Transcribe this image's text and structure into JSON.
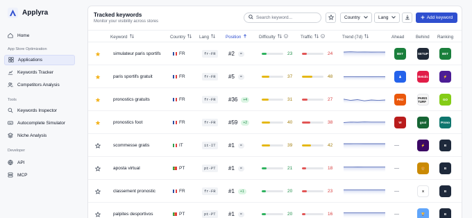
{
  "app": {
    "name": "Applyra"
  },
  "sidebar": {
    "top_items": [
      {
        "label": "Home",
        "icon": "home-icon"
      }
    ],
    "sections": [
      {
        "title": "App Store Optimization",
        "items": [
          {
            "label": "Applications",
            "icon": "apps-icon",
            "active": true
          },
          {
            "label": "Keywords Tracker",
            "icon": "chart-icon"
          },
          {
            "label": "Competitors Analysis",
            "icon": "users-icon"
          }
        ]
      },
      {
        "title": "Tools",
        "items": [
          {
            "label": "Keywords Inspector",
            "icon": "search-icon"
          },
          {
            "label": "Autocomplete Simulator",
            "icon": "keyboard-icon"
          },
          {
            "label": "Niche Analysis",
            "icon": "layers-icon"
          }
        ]
      },
      {
        "title": "Developer",
        "items": [
          {
            "label": "API",
            "icon": "globe-icon"
          },
          {
            "label": "MCP",
            "icon": "server-icon"
          }
        ]
      }
    ]
  },
  "header": {
    "title": "Tracked keywords",
    "subtitle": "Monitor your visibility across stores",
    "search_placeholder": "Search keyword...",
    "country_label": "Country",
    "lang_label": "Lang",
    "add_label": "Add keyword"
  },
  "columns": [
    "Keyword",
    "Country",
    "Lang",
    "Position",
    "Difficulty",
    "Traffic",
    "Trend (7d)",
    "Ahead",
    "Behind",
    "Ranking"
  ],
  "colors": {
    "accent": "#2f4fcf",
    "good": "#1e8e49",
    "medium": "#a17c0a",
    "bad": "#d63b3b"
  },
  "rows": [
    {
      "starred": true,
      "keyword": "simulateur paris sportifs",
      "country": "FR",
      "lang": "fr-FR",
      "position": "#2",
      "change": "=",
      "difficulty": 23,
      "traffic": 24,
      "trend": [
        0.75,
        0.78,
        0.76,
        0.77,
        0.75,
        0.76,
        0.75
      ],
      "ahead": {
        "text": "BET",
        "color": "#1a7f3c"
      },
      "behind": {
        "text": "SETUP",
        "color": "#1f2937"
      },
      "ranking": {
        "text": "BET",
        "color": "#1a7f3c"
      }
    },
    {
      "starred": true,
      "keyword": "paris sportifs gratuit",
      "country": "FR",
      "lang": "fr-FR",
      "position": "#5",
      "change": "=",
      "difficulty": 37,
      "traffic": 48,
      "trend": [
        0.55,
        0.56,
        0.55,
        0.56,
        0.55,
        0.56,
        0.55
      ],
      "ahead": {
        "text": "♟",
        "color": "#2563eb"
      },
      "behind": {
        "text": "Betclic",
        "color": "#e11d48"
      },
      "ranking": {
        "text": "⚡",
        "color": "#4c1d95"
      }
    },
    {
      "starred": true,
      "keyword": "pronostics gratuits",
      "country": "FR",
      "lang": "fr-FR",
      "position": "#36",
      "change": "+4",
      "difficulty": 31,
      "traffic": 27,
      "trend": [
        0.6,
        0.45,
        0.55,
        0.4,
        0.5,
        0.45,
        0.5
      ],
      "ahead": {
        "text": "PRO",
        "color": "#ea580c"
      },
      "behind": {
        "text": "PARIS TURF",
        "color": "#f5f5f5"
      },
      "ranking": {
        "text": "GO",
        "color": "#84cc16"
      }
    },
    {
      "starred": true,
      "keyword": "pronostics foot",
      "country": "FR",
      "lang": "fr-FR",
      "position": "#59",
      "change": "+2",
      "difficulty": 40,
      "traffic": 38,
      "trend": [
        0.55,
        0.6,
        0.58,
        0.62,
        0.6,
        0.6,
        0.6
      ],
      "ahead": {
        "text": "W",
        "color": "#b91c1c"
      },
      "behind": {
        "text": "goal",
        "color": "#166534"
      },
      "ranking": {
        "text": "Prono",
        "color": "#0f766e"
      }
    },
    {
      "starred": false,
      "keyword": "scommesse gratis",
      "country": "IT",
      "lang": "it-IT",
      "position": "#1",
      "change": "=",
      "difficulty": 39,
      "traffic": 42,
      "trend": [
        0.75,
        0.75,
        0.76,
        0.75,
        0.75,
        0.75,
        0.75
      ],
      "ahead": null,
      "behind": {
        "text": "⚡",
        "color": "#3b0764"
      },
      "ranking": {
        "text": "B",
        "color": "#1e293b"
      }
    },
    {
      "starred": false,
      "keyword": "aposta virtual",
      "country": "PT",
      "lang": "pt-PT",
      "position": "#1",
      "change": "=",
      "difficulty": 21,
      "traffic": 18,
      "trend": [
        0.7,
        0.7,
        0.71,
        0.7,
        0.7,
        0.7,
        0.7
      ],
      "ahead": null,
      "behind": {
        "text": "🍔",
        "color": "#ca8a04"
      },
      "ranking": {
        "text": "B",
        "color": "#1e293b"
      }
    },
    {
      "starred": false,
      "keyword": "classement pronostic",
      "country": "FR",
      "lang": "fr-FR",
      "position": "#1",
      "change": "+1",
      "difficulty": 20,
      "traffic": 23,
      "trend": [
        0.72,
        0.72,
        0.72,
        0.72,
        0.72,
        0.72,
        0.72
      ],
      "ahead": null,
      "behind": {
        "text": "X",
        "color": "#ffffff"
      },
      "ranking": {
        "text": "B",
        "color": "#1e293b"
      }
    },
    {
      "starred": false,
      "keyword": "palpites desportivos",
      "country": "PT",
      "lang": "pt-PT",
      "position": "#1",
      "change": "=",
      "difficulty": 20,
      "traffic": 16,
      "trend": [
        0.7,
        0.7,
        0.7,
        0.7,
        0.7,
        0.7,
        0.7
      ],
      "ahead": null,
      "behind": {
        "text": "🏆",
        "color": "#60a5fa"
      },
      "ranking": {
        "text": "B",
        "color": "#1e293b"
      }
    }
  ],
  "empty_cell": "—"
}
